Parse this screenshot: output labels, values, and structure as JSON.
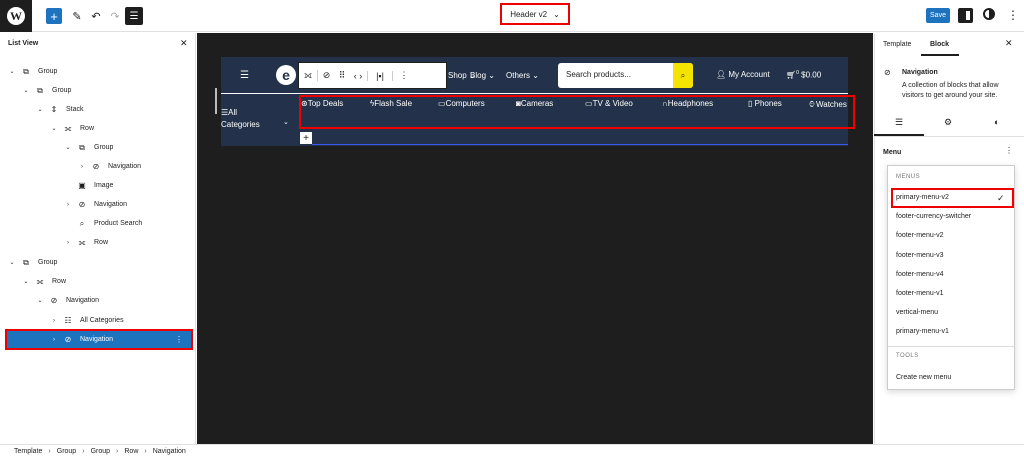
{
  "topbar": {
    "doc_title": "Header v2",
    "save_label": "Save"
  },
  "list_view": {
    "title": "List View",
    "items": [
      {
        "label": "Group"
      },
      {
        "label": "Group"
      },
      {
        "label": "Stack"
      },
      {
        "label": "Row"
      },
      {
        "label": "Group"
      },
      {
        "label": "Navigation"
      },
      {
        "label": "Image"
      },
      {
        "label": "Navigation"
      },
      {
        "label": "Product Search"
      },
      {
        "label": "Row"
      },
      {
        "label": "Group"
      },
      {
        "label": "Row"
      },
      {
        "label": "Navigation"
      },
      {
        "label": "All Categories"
      },
      {
        "label": "Navigation"
      }
    ]
  },
  "canvas": {
    "top_links": [
      "Shop",
      "Blog",
      "Others"
    ],
    "search_placeholder": "Search products...",
    "account_label": "My Account",
    "cart_total": "$0.00",
    "cart_count": "0",
    "all_categories": [
      "All",
      "Categories"
    ],
    "categories": [
      "Top Deals",
      "Flash Sale",
      "Computers",
      "Cameras",
      "TV & Video",
      "Headphones",
      "Phones",
      "Watches"
    ]
  },
  "right_panel": {
    "tabs": [
      "Template",
      "Block"
    ],
    "block_title": "Navigation",
    "block_desc": "A collection of blocks that allow visitors to get around your site.",
    "menu_label": "Menu",
    "menus_heading": "MENUS",
    "menus": [
      "primary-menu-v2",
      "footer-currency-switcher",
      "footer-menu-v2",
      "footer-menu-v3",
      "footer-menu-v4",
      "footer-menu-v1",
      "vertical-menu",
      "primary-menu-v1"
    ],
    "tools_heading": "TOOLS",
    "tools": [
      "Create new menu"
    ]
  },
  "breadcrumb": [
    "Template",
    "Group",
    "Group",
    "Row",
    "Navigation"
  ],
  "colors": {
    "accent": "#1e73be",
    "header_bg": "#23324a",
    "highlight": "#e00000",
    "search_button": "#f4e300"
  }
}
